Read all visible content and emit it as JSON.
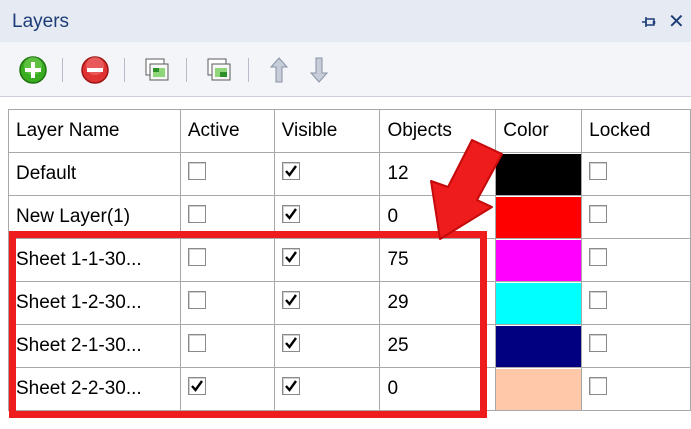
{
  "window": {
    "title": "Layers"
  },
  "toolbar": {
    "buttons": [
      {
        "name": "add-layer-button",
        "icon": "plus-circle-icon",
        "color": "#2f9e1d"
      },
      {
        "name": "remove-layer-button",
        "icon": "minus-circle-icon",
        "color": "#d92828"
      },
      {
        "name": "layer-properties-button",
        "icon": "layer-image-icon"
      },
      {
        "name": "layer-copy-button",
        "icon": "layer-image-icon"
      },
      {
        "name": "move-up-button",
        "icon": "arrow-up-icon"
      },
      {
        "name": "move-down-button",
        "icon": "arrow-down-icon"
      }
    ]
  },
  "table": {
    "columns": [
      "Layer Name",
      "Active",
      "Visible",
      "Objects",
      "Color",
      "Locked"
    ],
    "rows": [
      {
        "name": "Default",
        "active": false,
        "visible": true,
        "objects": "12",
        "color": "#000000",
        "locked": false
      },
      {
        "name": "New Layer(1)",
        "active": false,
        "visible": true,
        "objects": "0",
        "color": "#ff0000",
        "locked": false
      },
      {
        "name": "Sheet 1-1-30...",
        "active": false,
        "visible": true,
        "objects": "75",
        "color": "#ff00ff",
        "locked": false
      },
      {
        "name": "Sheet 1-2-30...",
        "active": false,
        "visible": true,
        "objects": "29",
        "color": "#00ffff",
        "locked": false
      },
      {
        "name": "Sheet 2-1-30...",
        "active": false,
        "visible": true,
        "objects": "25",
        "color": "#000080",
        "locked": false
      },
      {
        "name": "Sheet 2-2-30...",
        "active": true,
        "visible": true,
        "objects": "0",
        "color": "#ffc8a8",
        "locked": false
      }
    ]
  },
  "annotation": {
    "highlight_color": "#ee1c1c"
  }
}
